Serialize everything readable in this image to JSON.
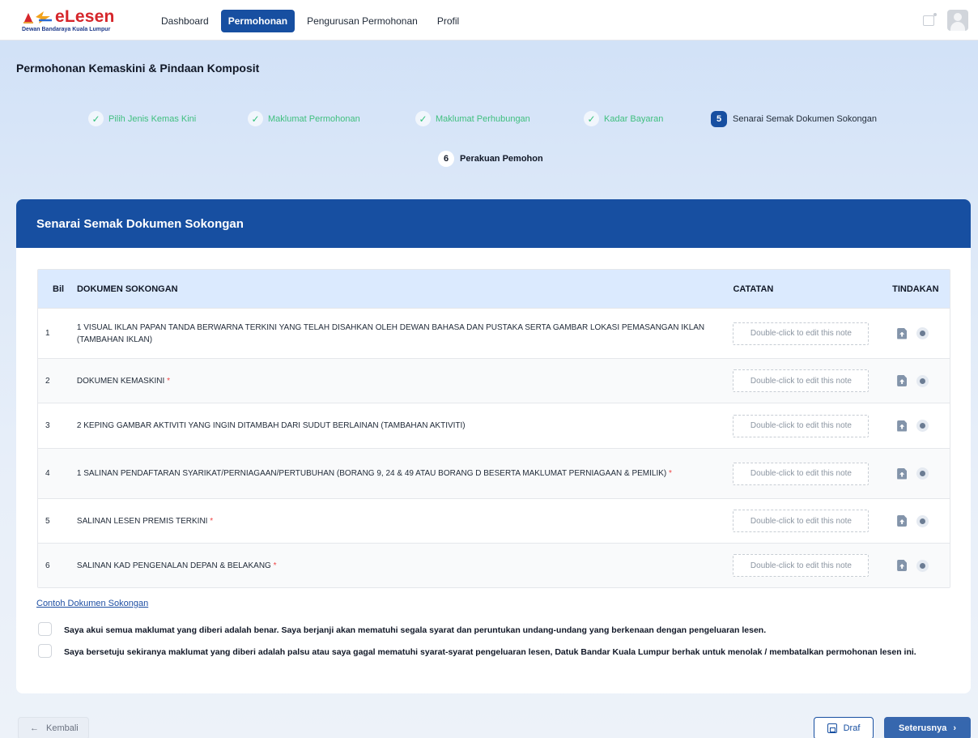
{
  "brand": {
    "name": "eLesen",
    "subtitle": "Dewan Bandaraya Kuala Lumpur"
  },
  "nav": {
    "items": [
      {
        "label": "Dashboard",
        "active": false
      },
      {
        "label": "Permohonan",
        "active": true
      },
      {
        "label": "Pengurusan Permohonan",
        "active": false
      },
      {
        "label": "Profil",
        "active": false
      }
    ]
  },
  "page": {
    "title": "Permohonan Kemaskini & Pindaan Komposit"
  },
  "stepper": {
    "steps": [
      {
        "label": "Pilih Jenis Kemas Kini",
        "status": "done"
      },
      {
        "label": "Maklumat Permohonan",
        "status": "done"
      },
      {
        "label": "Maklumat Perhubungan",
        "status": "done"
      },
      {
        "label": "Kadar Bayaran",
        "status": "done"
      },
      {
        "number": "5",
        "label": "Senarai Semak Dokumen Sokongan",
        "status": "current"
      },
      {
        "number": "6",
        "label": "Perakuan Pemohon",
        "status": "next"
      }
    ]
  },
  "card": {
    "title": "Senarai Semak Dokumen Sokongan"
  },
  "table": {
    "headers": {
      "bil": "Bil",
      "doc": "DOKUMEN SOKONGAN",
      "note": "CATATAN",
      "action": "TINDAKAN"
    },
    "note_placeholder": "Double-click to edit this note",
    "rows": [
      {
        "bil": "1",
        "doc": "1 VISUAL IKLAN PAPAN TANDA BERWARNA TERKINI YANG TELAH DISAHKAN OLEH DEWAN BAHASA DAN PUSTAKA SERTA GAMBAR LOKASI PEMASANGAN IKLAN (TAMBAHAN IKLAN)",
        "required": ""
      },
      {
        "bil": "2",
        "doc": "DOKUMEN KEMASKINI",
        "required": "*"
      },
      {
        "bil": "3",
        "doc": "2 KEPING GAMBAR AKTIVITI YANG INGIN DITAMBAH DARI SUDUT BERLAINAN (TAMBAHAN AKTIVITI)",
        "required": ""
      },
      {
        "bil": "4",
        "doc": "1 SALINAN PENDAFTARAN SYARIKAT/PERNIAGAAN/PERTUBUHAN (BORANG 9, 24 & 49 ATAU BORANG D BESERTA MAKLUMAT PERNIAGAAN & PEMILIK)",
        "required": "*"
      },
      {
        "bil": "5",
        "doc": "SALINAN LESEN PREMIS TERKINI",
        "required": "*"
      },
      {
        "bil": "6",
        "doc": "SALINAN KAD PENGENALAN DEPAN & BELAKANG",
        "required": "*"
      }
    ]
  },
  "sample_link": "Contoh Dokumen Sokongan",
  "declarations": [
    "Saya akui semua maklumat yang diberi adalah benar. Saya berjanji akan mematuhi segala syarat dan peruntukan undang-undang yang berkenaan dengan pengeluaran lesen.",
    "Saya bersetuju sekiranya maklumat yang diberi adalah palsu atau saya gagal mematuhi syarat-syarat pengeluaran lesen, Datuk Bandar Kuala Lumpur berhak untuk menolak / membatalkan permohonan lesen ini."
  ],
  "footer": {
    "back": "Kembali",
    "draft": "Draf",
    "next": "Seterusnya"
  },
  "colors": {
    "primary": "#174fa1",
    "success": "#3fbf7f",
    "required": "#ef4444"
  }
}
